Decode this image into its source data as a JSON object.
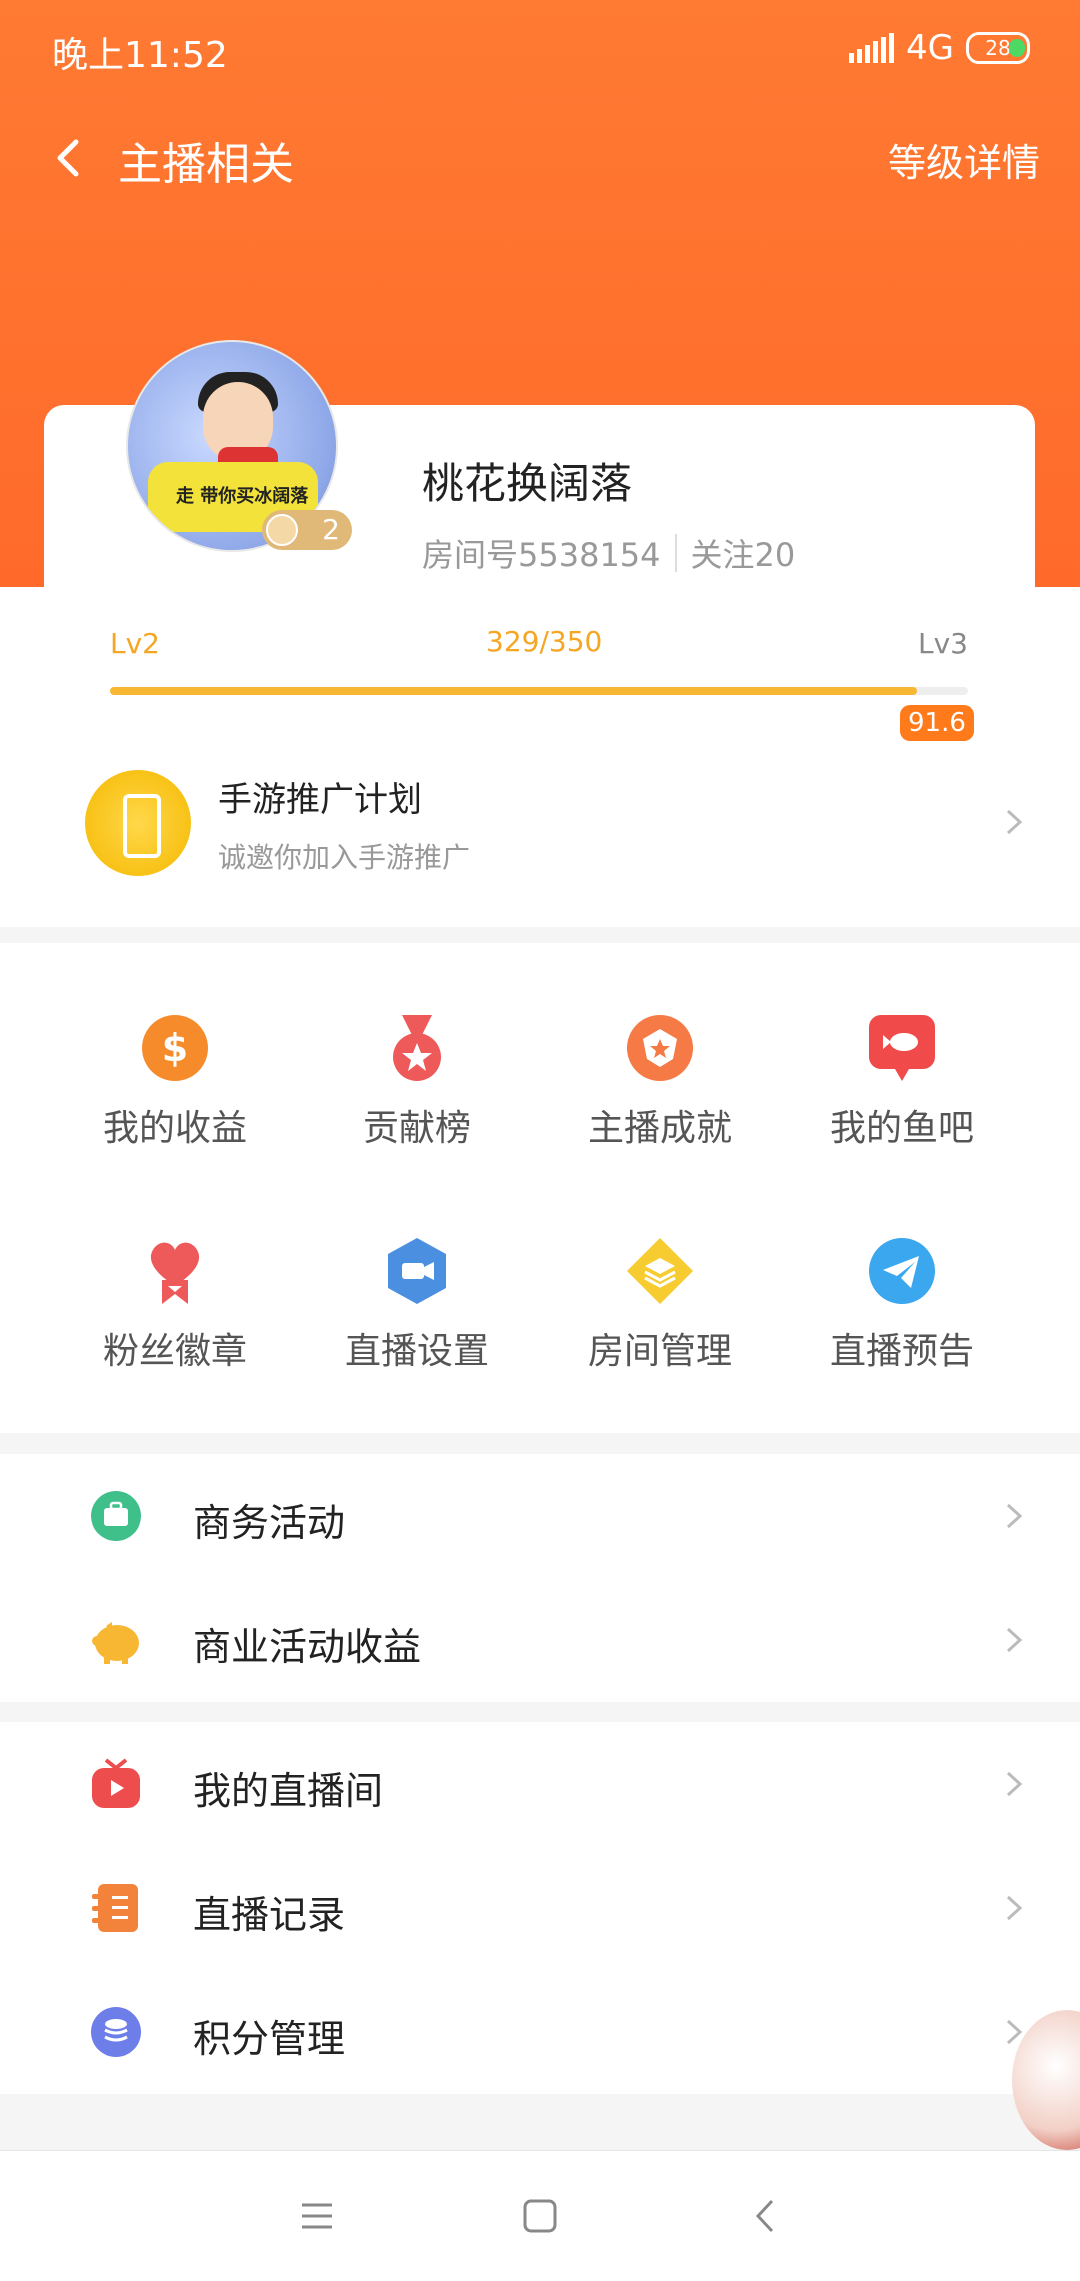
{
  "status_bar": {
    "time": "晚上11:52",
    "network": "4G",
    "battery": "28"
  },
  "header": {
    "title": "主播相关",
    "right_action": "等级详情"
  },
  "profile": {
    "avatar_text": "走 带你买冰阔落",
    "level_badge": "2",
    "username": "桃花换阔落",
    "room": "房间号5538154",
    "follow": "关注20"
  },
  "level": {
    "current": "Lv2",
    "progress_text": "329/350",
    "next": "Lv3",
    "progress_fraction": 0.94,
    "badge": "91.6"
  },
  "promo": {
    "title": "手游推广计划",
    "subtitle": "诚邀你加入手游推广"
  },
  "grid": [
    {
      "label": "我的收益",
      "icon": "dollar-icon",
      "color": "#f68b2c"
    },
    {
      "label": "贡献榜",
      "icon": "medal-icon",
      "color": "#ee5a5a"
    },
    {
      "label": "主播成就",
      "icon": "achievement-icon",
      "color": "#f57a45"
    },
    {
      "label": "我的鱼吧",
      "icon": "fish-icon",
      "color": "#f04a4a"
    },
    {
      "label": "粉丝徽章",
      "icon": "heart-badge-icon",
      "color": "#ee5a5a"
    },
    {
      "label": "直播设置",
      "icon": "camera-icon",
      "color": "#4a8fe0"
    },
    {
      "label": "房间管理",
      "icon": "layers-icon",
      "color": "#f6cc30"
    },
    {
      "label": "直播预告",
      "icon": "paper-plane-icon",
      "color": "#3aa7ee"
    }
  ],
  "list_group1": [
    {
      "label": "商务活动",
      "icon": "briefcase-icon"
    },
    {
      "label": "商业活动收益",
      "icon": "piggy-bank-icon"
    }
  ],
  "list_group2": [
    {
      "label": "我的直播间",
      "icon": "tv-icon"
    },
    {
      "label": "直播记录",
      "icon": "record-book-icon"
    },
    {
      "label": "积分管理",
      "icon": "coins-icon"
    }
  ]
}
